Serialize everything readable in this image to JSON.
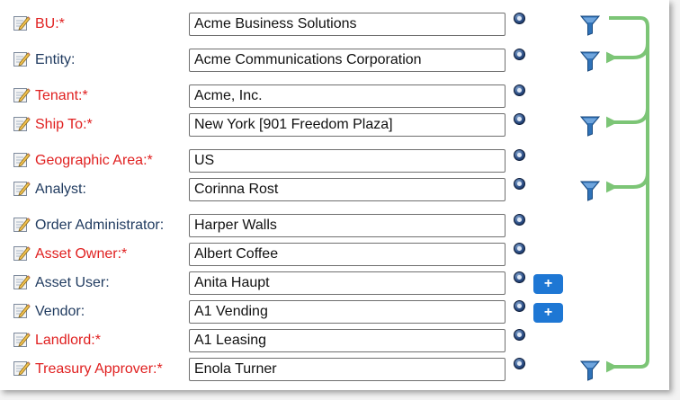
{
  "colors": {
    "required_label": "#e02020",
    "optional_label": "#1f3a5f",
    "connector": "#7cc576",
    "add_button": "#1e77d4",
    "filter": "#2f72b8"
  },
  "rows": [
    {
      "label": "BU:*",
      "value": "Acme Business Solutions",
      "required": true,
      "filter": true,
      "add": false
    },
    {
      "label": "Entity:",
      "value": "Acme Communications Corporation",
      "required": false,
      "filter": true,
      "add": false
    },
    {
      "label": "Tenant:*",
      "value": "Acme, Inc.",
      "required": true,
      "filter": false,
      "add": false
    },
    {
      "label": "Ship To:*",
      "value": "New York [901 Freedom Plaza]",
      "required": true,
      "filter": true,
      "add": false
    },
    {
      "label": "Geographic Area:*",
      "value": "US",
      "required": true,
      "filter": false,
      "add": false
    },
    {
      "label": "Analyst:",
      "value": "Corinna Rost",
      "required": false,
      "filter": true,
      "add": false
    },
    {
      "label": "Order Administrator:",
      "value": "Harper Walls",
      "required": false,
      "filter": false,
      "add": false
    },
    {
      "label": "Asset Owner:*",
      "value": "Albert Coffee",
      "required": true,
      "filter": false,
      "add": false
    },
    {
      "label": "Asset User:",
      "value": "Anita Haupt",
      "required": false,
      "filter": false,
      "add": true
    },
    {
      "label": "Vendor:",
      "value": "A1 Vending",
      "required": false,
      "filter": false,
      "add": true
    },
    {
      "label": "Landlord:*",
      "value": "A1 Leasing",
      "required": true,
      "filter": false,
      "add": false
    },
    {
      "label": "Treasury Approver:*",
      "value": "Enola Turner",
      "required": true,
      "filter": true,
      "add": false
    }
  ],
  "add_button_label": "+",
  "icons": {
    "edit": "edit-pencil-icon",
    "lookup": "lookup-dot-icon",
    "filter": "filter-funnel-icon"
  }
}
